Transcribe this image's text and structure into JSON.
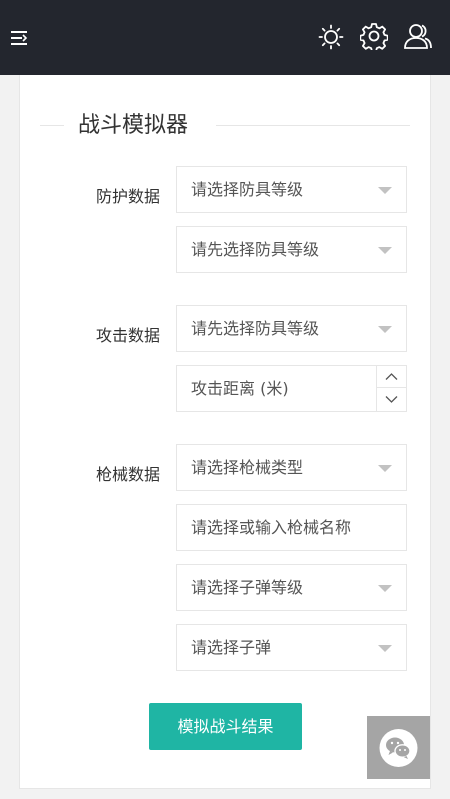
{
  "header": {
    "icons": [
      "menu-icon",
      "sun-icon",
      "gear-icon",
      "user-icon"
    ]
  },
  "form": {
    "title": "战斗模拟器",
    "defense": {
      "label": "防护数据",
      "armor_level": "请选择防具等级",
      "armor_item": "请先选择防具等级"
    },
    "attack": {
      "label": "攻击数据",
      "armor_item": "请先选择防具等级",
      "distance": "攻击距离 (米)"
    },
    "weapon": {
      "label": "枪械数据",
      "type": "请选择枪械类型",
      "name": "请选择或输入枪械名称",
      "ammo_level": "请选择子弹等级",
      "ammo": "请选择子弹"
    },
    "submit": "模拟战斗结果"
  },
  "colors": {
    "header_bg": "#23262e",
    "accent": "#1fb5a4",
    "chat_fab": "#a5a5a5"
  }
}
